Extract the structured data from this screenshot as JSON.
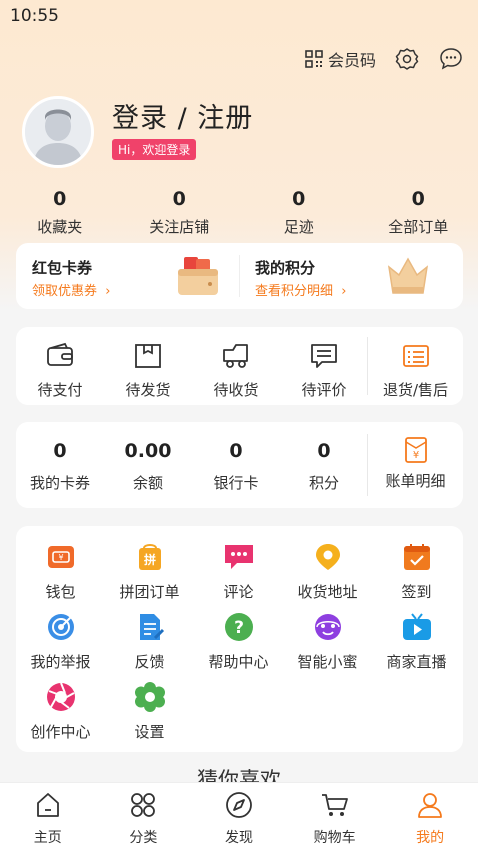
{
  "status": {
    "time": "10:55"
  },
  "header": {
    "member_code_label": "会员码"
  },
  "profile": {
    "login_label": "登录 / 注册",
    "greeting": "Hi，欢迎登录"
  },
  "stats": [
    {
      "value": "0",
      "label": "收藏夹"
    },
    {
      "value": "0",
      "label": "关注店铺"
    },
    {
      "value": "0",
      "label": "足迹"
    },
    {
      "value": "0",
      "label": "全部订单"
    }
  ],
  "promo": {
    "coupon": {
      "title": "红包卡券",
      "link": "领取优惠券"
    },
    "points": {
      "title": "我的积分",
      "link": "查看积分明细"
    }
  },
  "orders": [
    {
      "label": "待支付",
      "icon": "wallet-icon"
    },
    {
      "label": "待发货",
      "icon": "box-icon"
    },
    {
      "label": "待收货",
      "icon": "truck-icon"
    },
    {
      "label": "待评价",
      "icon": "comment-icon"
    },
    {
      "label": "退货/售后",
      "icon": "return-list-icon"
    }
  ],
  "assets": [
    {
      "value": "0",
      "label": "我的卡券"
    },
    {
      "value": "0.00",
      "label": "余额"
    },
    {
      "value": "0",
      "label": "银行卡"
    },
    {
      "value": "0",
      "label": "积分"
    }
  ],
  "bill": {
    "label": "账单明细",
    "icon_char": "¥"
  },
  "tools": [
    {
      "label": "钱包",
      "icon": "wallet-icon",
      "color": "#f06a2a"
    },
    {
      "label": "拼团订单",
      "icon": "group-buy-icon",
      "color": "#f5a623",
      "icon_char": "拼"
    },
    {
      "label": "评论",
      "icon": "comment-icon",
      "color": "#e8336f"
    },
    {
      "label": "收货地址",
      "icon": "location-icon",
      "color": "#f5b01d"
    },
    {
      "label": "签到",
      "icon": "calendar-check-icon",
      "color": "#f07a1e"
    },
    {
      "label": "我的举报",
      "icon": "report-target-icon",
      "color": "#3a8ee6"
    },
    {
      "label": "反馈",
      "icon": "feedback-doc-icon",
      "color": "#2f8de4"
    },
    {
      "label": "帮助中心",
      "icon": "help-icon",
      "color": "#4caf50",
      "icon_char": "?"
    },
    {
      "label": "智能小蜜",
      "icon": "assistant-icon",
      "color": "#8e3fe0"
    },
    {
      "label": "商家直播",
      "icon": "live-icon",
      "color": "#1a9be6"
    },
    {
      "label": "创作中心",
      "icon": "aperture-icon",
      "color": "#e8336f"
    },
    {
      "label": "设置",
      "icon": "settings-flower-icon",
      "color": "#4caf50"
    }
  ],
  "guess_title": "猜你喜欢",
  "tabbar": [
    {
      "label": "主页",
      "icon": "home-icon",
      "active": false
    },
    {
      "label": "分类",
      "icon": "category-icon",
      "active": false
    },
    {
      "label": "发现",
      "icon": "compass-icon",
      "active": false
    },
    {
      "label": "购物车",
      "icon": "cart-icon",
      "active": false
    },
    {
      "label": "我的",
      "icon": "user-icon",
      "active": true
    }
  ],
  "colors": {
    "accent": "#f57a1d",
    "badge": "#f0426a"
  }
}
